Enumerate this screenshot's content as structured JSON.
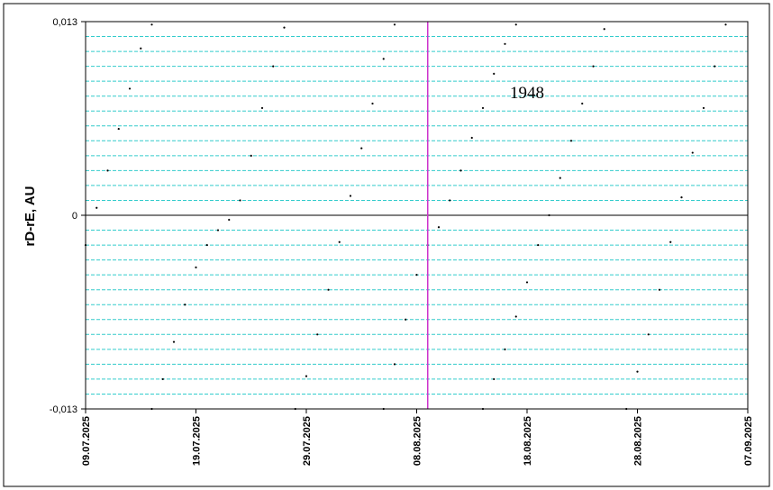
{
  "chart_data": {
    "type": "scatter",
    "ylabel": "rD-rE, AU",
    "ylim": [
      -0.013,
      0.013
    ],
    "xlim": [
      "2025-07-09",
      "2025-09-07"
    ],
    "y_tick_labels": [
      "0,013",
      "0",
      "-0,013"
    ],
    "x_tick_labels": [
      "09.07.2025",
      "19.07.2025",
      "29.07.2025",
      "08.08.2025",
      "18.08.2025",
      "28.08.2025",
      "07.09.2025"
    ],
    "annotation": "1948",
    "marker_date": "2025-08-09",
    "grid": true,
    "colors": {
      "grid": "#33cccc",
      "marker_line": "#cc33cc",
      "points": "#000000",
      "zero_line": "#000000",
      "frame": "#000000"
    },
    "series": [
      {
        "points": [
          [
            "2025-07-09",
            -0.002
          ],
          [
            "2025-07-10",
            0.0005
          ],
          [
            "2025-07-11",
            0.003
          ],
          [
            "2025-07-12",
            0.0058
          ],
          [
            "2025-07-13",
            0.0085
          ],
          [
            "2025-07-14",
            0.0112
          ],
          [
            "2025-07-15",
            0.0128
          ],
          [
            "2025-07-15",
            -0.013
          ],
          [
            "2025-07-16",
            -0.011
          ],
          [
            "2025-07-17",
            -0.0085
          ],
          [
            "2025-07-18",
            -0.006
          ],
          [
            "2025-07-19",
            -0.0035
          ],
          [
            "2025-07-20",
            -0.002
          ],
          [
            "2025-07-21",
            -0.001
          ],
          [
            "2025-07-22",
            -0.0003
          ],
          [
            "2025-07-23",
            0.001
          ],
          [
            "2025-07-24",
            0.004
          ],
          [
            "2025-07-25",
            0.0072
          ],
          [
            "2025-07-26",
            0.01
          ],
          [
            "2025-07-27",
            0.0126
          ],
          [
            "2025-07-28",
            -0.013
          ],
          [
            "2025-07-29",
            -0.0108
          ],
          [
            "2025-07-30",
            -0.008
          ],
          [
            "2025-07-31",
            -0.005
          ],
          [
            "2025-08-01",
            -0.0018
          ],
          [
            "2025-08-02",
            0.0013
          ],
          [
            "2025-08-03",
            0.0045
          ],
          [
            "2025-08-04",
            0.0075
          ],
          [
            "2025-08-05",
            0.0105
          ],
          [
            "2025-08-06",
            0.0128
          ],
          [
            "2025-08-05",
            -0.013
          ],
          [
            "2025-08-06",
            -0.01
          ],
          [
            "2025-08-07",
            -0.007
          ],
          [
            "2025-08-08",
            -0.004
          ],
          [
            "2025-08-09",
            -0.002
          ],
          [
            "2025-08-10",
            -0.0008
          ],
          [
            "2025-08-11",
            0.001
          ],
          [
            "2025-08-12",
            0.003
          ],
          [
            "2025-08-13",
            0.0052
          ],
          [
            "2025-08-14",
            0.0072
          ],
          [
            "2025-08-15",
            0.0095
          ],
          [
            "2025-08-16",
            0.0115
          ],
          [
            "2025-08-17",
            0.0128
          ],
          [
            "2025-08-14",
            -0.013
          ],
          [
            "2025-08-15",
            -0.011
          ],
          [
            "2025-08-16",
            -0.009
          ],
          [
            "2025-08-17",
            -0.0068
          ],
          [
            "2025-08-18",
            -0.0045
          ],
          [
            "2025-08-19",
            -0.002
          ],
          [
            "2025-08-20",
            0.0
          ],
          [
            "2025-08-21",
            0.0025
          ],
          [
            "2025-08-22",
            0.005
          ],
          [
            "2025-08-23",
            0.0075
          ],
          [
            "2025-08-24",
            0.01
          ],
          [
            "2025-08-25",
            0.0125
          ],
          [
            "2025-08-27",
            -0.013
          ],
          [
            "2025-08-28",
            -0.0105
          ],
          [
            "2025-08-29",
            -0.008
          ],
          [
            "2025-08-30",
            -0.005
          ],
          [
            "2025-08-31",
            -0.0018
          ],
          [
            "2025-09-01",
            0.0012
          ],
          [
            "2025-09-02",
            0.0042
          ],
          [
            "2025-09-03",
            0.0072
          ],
          [
            "2025-09-04",
            0.01
          ],
          [
            "2025-09-05",
            0.0128
          ]
        ]
      }
    ]
  }
}
